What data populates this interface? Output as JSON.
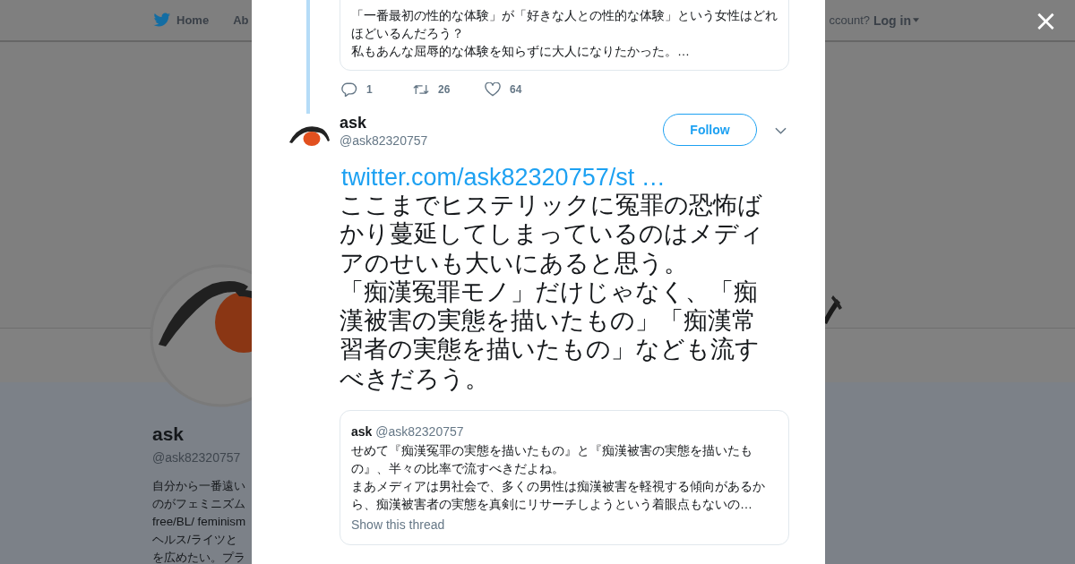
{
  "background_page": {
    "nav": {
      "items": [
        "Home",
        "Ab"
      ],
      "account_prompt": "ccount?",
      "login": "Log in"
    },
    "profile": {
      "name": "ask",
      "handle": "@ask82320757",
      "bio_lines": [
        "自分から一番遠い",
        "のがフェミニズム",
        "free/BL/ feminism",
        "ヘルス/ライツと",
        "を広めたい。プラ"
      ]
    }
  },
  "modal": {
    "close": "×",
    "previous_tweet": {
      "quote_lines": [
        "「一番最初の性的な体験」が「好きな人との性的な体験」という女性はどれほどいるんだろう？",
        "私もあんな屈辱的な体験を知らずに大人になりたかった。…"
      ],
      "actions": [
        {
          "kind": "reply",
          "count": "1"
        },
        {
          "kind": "retweet",
          "count": "26"
        },
        {
          "kind": "like",
          "count": "64"
        }
      ]
    },
    "tweet": {
      "name": "ask",
      "handle": "@ask82320757",
      "follow": "Follow",
      "link": "twitter.com/ask82320757/st …",
      "paragraphs": [
        "ここまでヒステリックに冤罪の恐怖ばかり蔓延してしまっているのはメディアのせいも大いにあると思う。",
        "「痴漢冤罪モノ」だけじゃなく、「痴漢被害の実態を描いたもの」「痴漢常習者の実態を描いたもの」なども流すべきだろう。"
      ],
      "quote": {
        "name": "ask",
        "handle": "@ask82320757",
        "paragraphs": [
          "せめて『痴漢冤罪の実態を描いたもの』と『痴漢被害の実態を描いたもの』、半々の比率で流すべきだよね。",
          "まあメディアは男社会で、多くの男性は痴漢被害を軽視する傾向があるから、痴漢被害者の実態を真剣にリサーチしようという着眼点もないの…"
        ],
        "show_thread": "Show this thread"
      }
    }
  }
}
